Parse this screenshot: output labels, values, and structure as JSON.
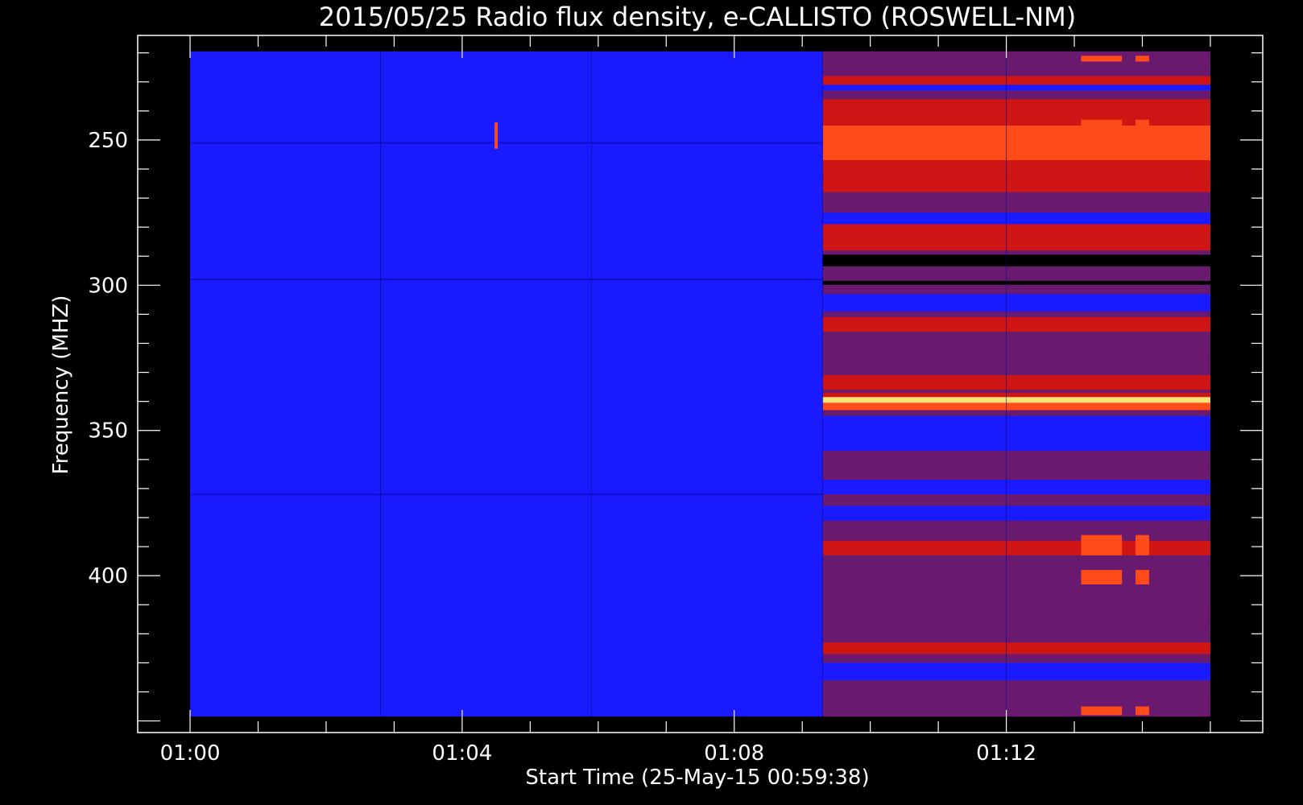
{
  "chart_data": {
    "type": "heatmap",
    "title": "2015/05/25  Radio flux density, e-CALLISTO (ROSWELL-NM)",
    "xlabel": "Start Time (25-May-15 00:59:38)",
    "ylabel": "Frequency (MHZ)",
    "x_ticks": [
      "01:00",
      "01:04",
      "01:08",
      "01:12"
    ],
    "x_tick_minutes": [
      0,
      4,
      8,
      12
    ],
    "x_range_minutes": [
      -0.77,
      15.77
    ],
    "data_x_range_minutes": [
      0,
      15
    ],
    "y_ticks": [
      250,
      300,
      350,
      400
    ],
    "y_range": [
      214,
      454
    ],
    "data_y_range": [
      219.5,
      448.5
    ],
    "y_inverted": true,
    "burst_onset_minute": 9.3,
    "colors": {
      "background": "#000000",
      "quiet": "#1a1aff",
      "quiet_dark": "#1010c8",
      "active": "#6a1a6e",
      "hot": "#d01515",
      "bright": "#ff4a1a",
      "peak": "#ffe070"
    },
    "bands_active": [
      {
        "f0": 219.5,
        "f1": 223,
        "level": "active"
      },
      {
        "f0": 228,
        "f1": 231,
        "level": "hot"
      },
      {
        "f0": 236,
        "f1": 245,
        "level": "hot"
      },
      {
        "f0": 245,
        "f1": 257,
        "level": "bright"
      },
      {
        "f0": 257,
        "f1": 263,
        "level": "hot"
      },
      {
        "f0": 263,
        "f1": 268,
        "level": "hot"
      },
      {
        "f0": 268,
        "f1": 273,
        "level": "active"
      },
      {
        "f0": 279,
        "f1": 288,
        "level": "hot"
      },
      {
        "f0": 311,
        "f1": 316,
        "level": "hot"
      },
      {
        "f0": 323,
        "f1": 330,
        "level": "active"
      },
      {
        "f0": 331,
        "f1": 336,
        "level": "hot"
      },
      {
        "f0": 337,
        "f1": 338.5,
        "level": "hot"
      },
      {
        "f0": 338.5,
        "f1": 340.5,
        "level": "peak"
      },
      {
        "f0": 340.5,
        "f1": 343,
        "level": "bright"
      },
      {
        "f0": 360,
        "f1": 365,
        "level": "active"
      },
      {
        "f0": 383,
        "f1": 388,
        "level": "active"
      },
      {
        "f0": 388,
        "f1": 393,
        "level": "hot"
      },
      {
        "f0": 393,
        "f1": 398,
        "level": "active"
      },
      {
        "f0": 410,
        "f1": 418,
        "level": "active"
      },
      {
        "f0": 423,
        "f1": 427,
        "level": "hot"
      },
      {
        "f0": 440,
        "f1": 448.5,
        "level": "active"
      }
    ],
    "bands_quiet_active": [
      {
        "f0": 230,
        "f1": 233
      },
      {
        "f0": 275,
        "f1": 279
      },
      {
        "f0": 303,
        "f1": 309
      },
      {
        "f0": 345,
        "f1": 352
      },
      {
        "f0": 352,
        "f1": 357
      },
      {
        "f0": 367,
        "f1": 372
      },
      {
        "f0": 376,
        "f1": 381
      },
      {
        "f0": 430,
        "f1": 436
      }
    ],
    "dark_bands": [
      {
        "f0": 289.5,
        "f1": 293.5
      },
      {
        "f0": 298.5,
        "f1": 299.8
      }
    ]
  }
}
